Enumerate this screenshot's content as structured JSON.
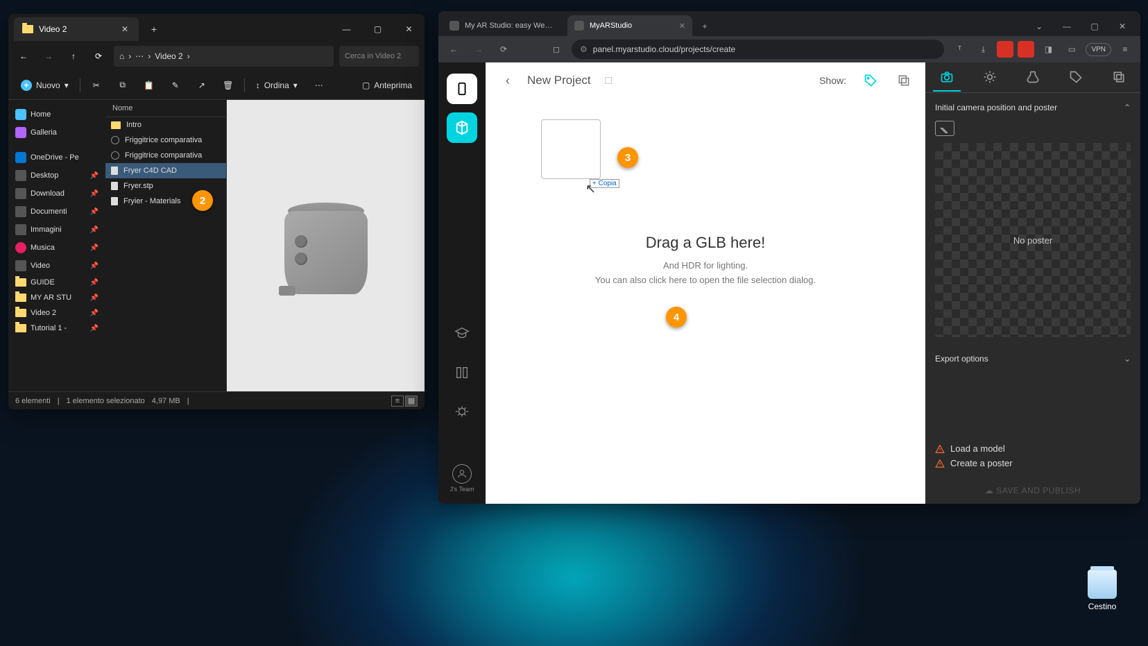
{
  "explorer": {
    "tab_title": "Video 2",
    "breadcrumb": "Video 2",
    "search_placeholder": "Cerca in Video 2",
    "new_btn": "Nuovo",
    "sort_btn": "Ordina",
    "preview_btn": "Anteprima",
    "list_header": "Nome",
    "sidebar": [
      {
        "label": "Home",
        "icon": "home"
      },
      {
        "label": "Galleria",
        "icon": "gal"
      },
      {
        "label": "OneDrive - Pe",
        "icon": "od"
      },
      {
        "label": "Desktop",
        "icon": "disk",
        "pin": true
      },
      {
        "label": "Download",
        "icon": "disk",
        "pin": true
      },
      {
        "label": "Documenti",
        "icon": "disk",
        "pin": true
      },
      {
        "label": "Immagini",
        "icon": "disk",
        "pin": true
      },
      {
        "label": "Musica",
        "icon": "mus",
        "pin": true
      },
      {
        "label": "Video",
        "icon": "disk",
        "pin": true
      },
      {
        "label": "GUIDE",
        "icon": "fold",
        "pin": true
      },
      {
        "label": "MY AR STU",
        "icon": "fold",
        "pin": true
      },
      {
        "label": "Video 2",
        "icon": "fold",
        "pin": true
      },
      {
        "label": "Tutorial 1 - ",
        "icon": "fold",
        "pin": true
      }
    ],
    "files": [
      {
        "name": "Intro",
        "icon": "fold"
      },
      {
        "name": "Friggitrice comparativa",
        "icon": "c4d"
      },
      {
        "name": "Friggitrice comparativa",
        "icon": "c4d"
      },
      {
        "name": "Fryer C4D CAD",
        "icon": "doc",
        "selected": true
      },
      {
        "name": "Fryer.stp",
        "icon": "doc"
      },
      {
        "name": "Fryier - Materials",
        "icon": "doc"
      }
    ],
    "status_items": "6 elementi",
    "status_selected": "1 elemento selezionato",
    "status_size": "4,97 MB"
  },
  "browser": {
    "tabs": [
      {
        "title": "My AR Studio: easy Web 3D Viewer",
        "active": false
      },
      {
        "title": "MyARStudio",
        "active": true
      }
    ],
    "url": "panel.myarstudio.cloud/projects/create",
    "vpn": "VPN",
    "team_label": "J's Team",
    "header": {
      "project_name": "New Project",
      "show_label": "Show:"
    },
    "drop": {
      "title": "Drag a GLB here!",
      "sub1": "And HDR for lighting.",
      "sub2": "You can also click here to open the file selection dialog."
    },
    "drag_tooltip": "+ Copia",
    "panel": {
      "section1": "Initial camera position and poster",
      "no_poster": "No poster",
      "section2": "Export options",
      "warn1": "Load a model",
      "warn2": "Create a poster",
      "publish": "SAVE AND PUBLISH"
    }
  },
  "badges": {
    "b2": "2",
    "b3": "3",
    "b4": "4"
  },
  "desktop": {
    "recycle": "Cestino"
  }
}
